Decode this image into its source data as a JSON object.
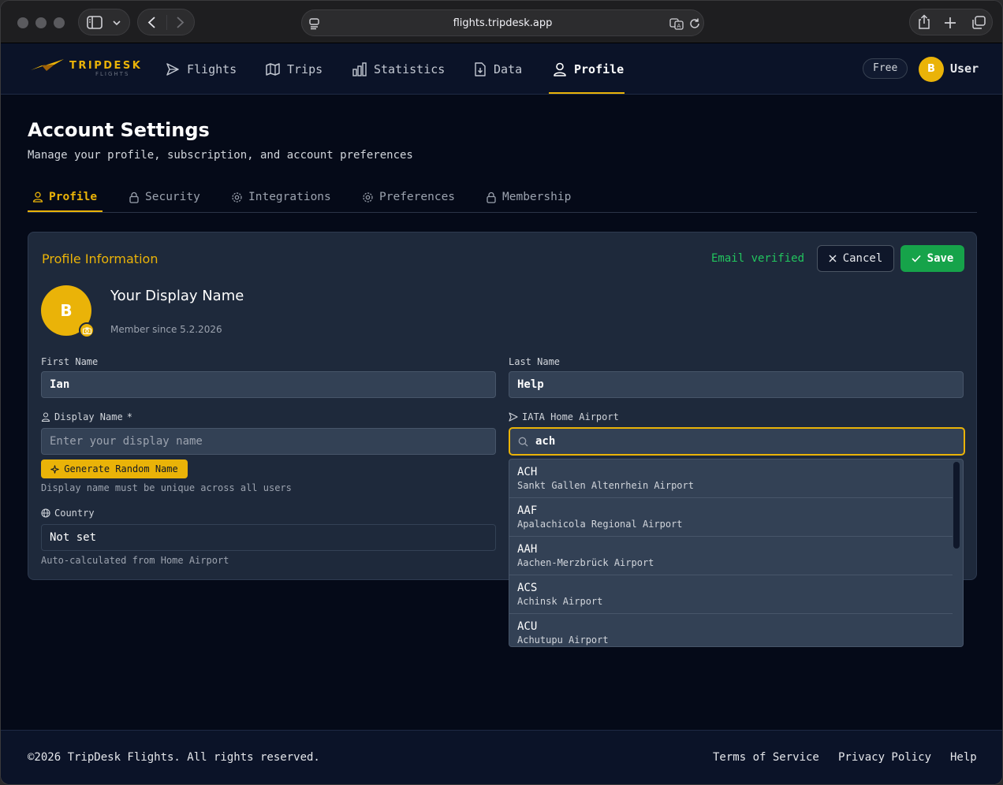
{
  "browser": {
    "url": "flights.tripdesk.app"
  },
  "brand": {
    "name": "TRIPDESK",
    "sub": "FLIGHTS",
    "accent": "#eab308"
  },
  "nav": {
    "items": [
      {
        "label": "Flights",
        "icon": "send-icon"
      },
      {
        "label": "Trips",
        "icon": "map-icon"
      },
      {
        "label": "Statistics",
        "icon": "bar-chart-icon"
      },
      {
        "label": "Data",
        "icon": "file-download-icon"
      },
      {
        "label": "Profile",
        "icon": "user-icon",
        "active": true
      }
    ],
    "plan_badge": "Free",
    "avatar_initial": "B",
    "user_label": "User"
  },
  "page": {
    "title": "Account Settings",
    "subtitle": "Manage your profile, subscription, and account preferences"
  },
  "tabs": [
    {
      "label": "Profile",
      "icon": "user-icon",
      "active": true
    },
    {
      "label": "Security",
      "icon": "lock-icon"
    },
    {
      "label": "Integrations",
      "icon": "gear-icon"
    },
    {
      "label": "Preferences",
      "icon": "gear-icon"
    },
    {
      "label": "Membership",
      "icon": "lock-icon"
    }
  ],
  "profile": {
    "section_title": "Profile Information",
    "email_status": "Email verified",
    "cancel_label": "Cancel",
    "save_label": "Save",
    "avatar_initial": "B",
    "display_name_title": "Your Display Name",
    "member_since": "Member since 5.2.2026",
    "first_name": {
      "label": "First Name",
      "value": "Ian"
    },
    "last_name": {
      "label": "Last Name",
      "value": "Help"
    },
    "display_name": {
      "label": "Display Name",
      "required": "*",
      "placeholder": "Enter your display name"
    },
    "generate_label": "Generate Random Name",
    "display_hint": "Display name must be unique across all users",
    "country": {
      "label": "Country",
      "value": "Not set",
      "hint": "Auto-calculated from Home Airport"
    },
    "home_airport": {
      "label": "IATA Home Airport",
      "value": "ach"
    }
  },
  "airport_options": [
    {
      "code": "ACH",
      "name": "Sankt Gallen Altenrhein Airport"
    },
    {
      "code": "AAF",
      "name": "Apalachicola Regional Airport"
    },
    {
      "code": "AAH",
      "name": "Aachen-Merzbrück Airport"
    },
    {
      "code": "ACS",
      "name": "Achinsk Airport"
    },
    {
      "code": "ACU",
      "name": "Achutupu Airport"
    }
  ],
  "footer": {
    "copyright": "©2026 TripDesk Flights. All rights reserved.",
    "links": [
      "Terms of Service",
      "Privacy Policy",
      "Help"
    ]
  }
}
